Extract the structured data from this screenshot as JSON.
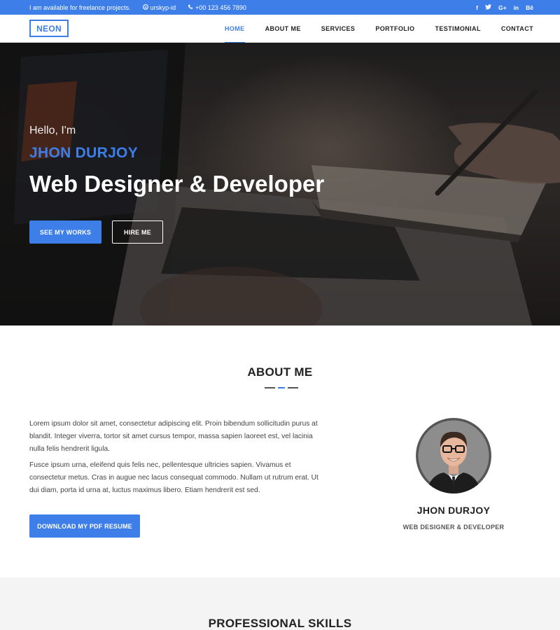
{
  "topbar": {
    "availability": "I am available for freelance projects.",
    "skype": "urskyp-id",
    "phone": "+00 123 456 7890",
    "social_icons": [
      "facebook-icon",
      "twitter-icon",
      "google-plus-icon",
      "linkedin-icon",
      "behance-icon"
    ],
    "social_glyphs": {
      "facebook": "f",
      "twitter": "t",
      "google_plus": "G+",
      "linkedin": "in",
      "behance": "Bē"
    }
  },
  "nav": {
    "logo": "NEON",
    "items": [
      {
        "label": "HOME",
        "active": true
      },
      {
        "label": "ABOUT ME",
        "active": false
      },
      {
        "label": "SERVICES",
        "active": false
      },
      {
        "label": "PORTFOLIO",
        "active": false
      },
      {
        "label": "TESTIMONIAL",
        "active": false
      },
      {
        "label": "CONTACT",
        "active": false
      }
    ]
  },
  "hero": {
    "greeting": "Hello, I'm",
    "name": "JHON DURJOY",
    "title": "Web Designer & Developer",
    "primary_button": "SEE MY WORKS",
    "secondary_button": "HIRE ME"
  },
  "about": {
    "title": "ABOUT ME",
    "paragraph1": "Lorem ipsum dolor sit amet, consectetur adipiscing elit. Proin bibendum sollicitudin purus at blandit. Integer viverra, tortor sit amet cursus tempor, massa sapien laoreet est, vel lacinia nulla felis hendrerit ligula.",
    "paragraph2": "Fusce ipsum urna, eleifend quis felis nec, pellentesque ultricies sapien. Vivamus et consectetur metus. Cras in augue nec lacus consequat commodo. Nullam ut rutrum erat. Ut dui diam, porta id urna at, luctus maximus libero. Etiam hendrerit est sed.",
    "resume_button": "DOWNLOAD MY PDF RESUME",
    "profile_name": "JHON DURJOY",
    "profile_role": "WEB DESIGNER & DEVELOPER"
  },
  "skills": {
    "title": "PROFESSIONAL SKILLS"
  },
  "colors": {
    "accent": "#3d7ee9",
    "dark_text": "#222222",
    "section_gray": "#f4f4f4"
  }
}
